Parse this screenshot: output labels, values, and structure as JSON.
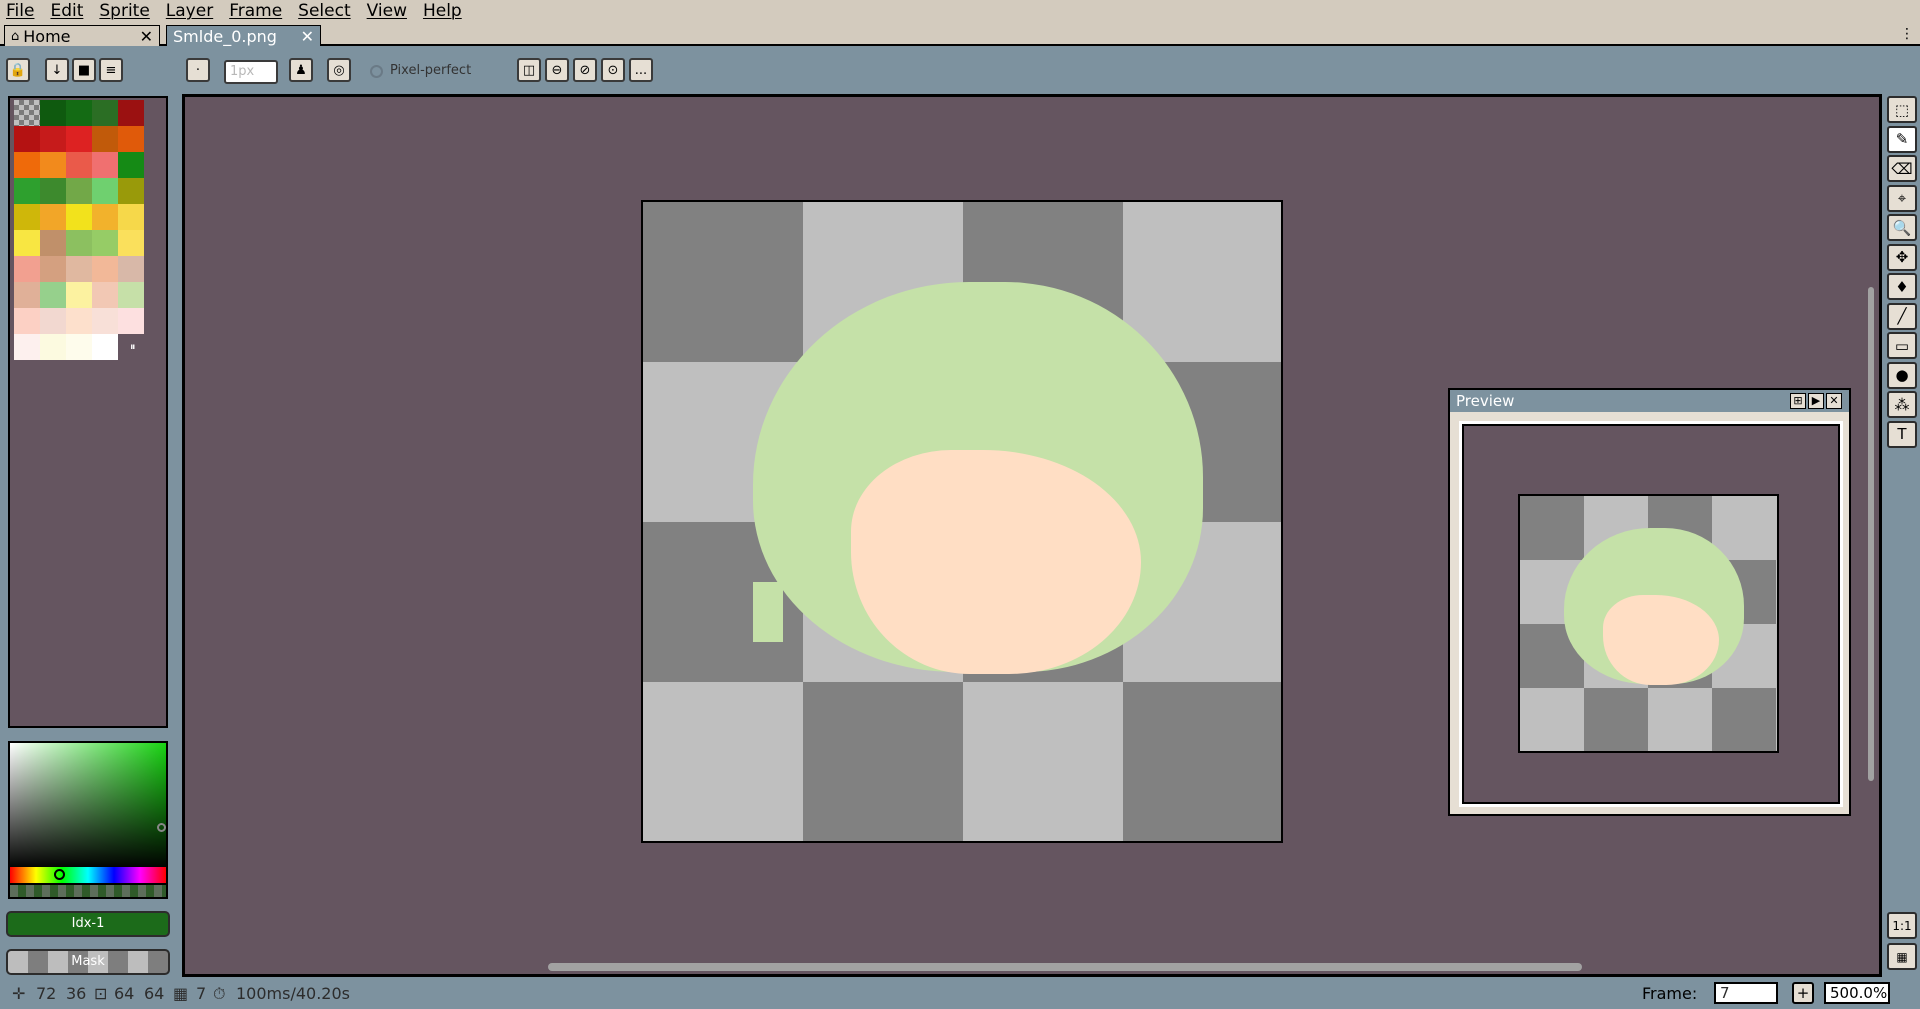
{
  "menu": [
    "File",
    "Edit",
    "Sprite",
    "Layer",
    "Frame",
    "Select",
    "View",
    "Help"
  ],
  "tabs": [
    {
      "label": "Home",
      "icon": "home-icon",
      "close": "✕"
    },
    {
      "label": "Smlde_0.png",
      "close": "✕"
    }
  ],
  "tabbar_menu_icon": "⋮",
  "toolbar": {
    "layer_buttons": [
      "🔒",
      "↓",
      "■",
      "≡"
    ],
    "brush_type_icon": "·",
    "brush_size_placeholder": "1px",
    "ink_icon": "♟",
    "pixel_perfect_label": "Pixel-perfect",
    "symmetry_buttons": [
      "◫",
      "⊖",
      "⊘",
      "⊙",
      "..."
    ]
  },
  "palette": {
    "colors": [
      "#7b7b7b",
      "#0f5a0f",
      "#146b14",
      "#2b6e24",
      "#9b1111",
      "#b41212",
      "#c61b1b",
      "#dd2222",
      "#c15a0a",
      "#e05a0a",
      "#ef6a0a",
      "#f28a1c",
      "#ea5a4a",
      "#f07070",
      "#158a15",
      "#2ea02e",
      "#3d8a2d",
      "#72a848",
      "#6fd06f",
      "#999a0a",
      "#cfb70a",
      "#f2a628",
      "#f2e21c",
      "#f2b22c",
      "#f6d84a",
      "#f8e642",
      "#c0906a",
      "#8cc060",
      "#96cc66",
      "#fae05c",
      "#f2a090",
      "#d4a080",
      "#e0b8a0",
      "#f2b898",
      "#d8b8a8",
      "#e0b098",
      "#96d08c",
      "#fcf2a0",
      "#f2c8b4",
      "#c6e0a8",
      "#fcd0c4",
      "#f2d8d0",
      "#fde0cc",
      "#f8e0d8",
      "#fde0e0",
      "#fdf0ee",
      "#fcfae0",
      "#fefcec",
      "#ffffff"
    ],
    "more_icon": "⏸"
  },
  "color_fg_label": "Idx-1",
  "color_bg_label": "Mask",
  "colors": {
    "accent": "#7d929f",
    "canvas_bg": "#655560",
    "checker_dark": "#818181",
    "checker_light": "#bfbfbf",
    "green_blob": "#c5e1a8",
    "peach_blob": "#ffdec4",
    "fg_color": "#1c6b1a"
  },
  "preview": {
    "title": "Preview",
    "buttons": [
      "⊞",
      "▶",
      "✕"
    ]
  },
  "tools": [
    {
      "name": "marquee-icon",
      "glyph": "⬚"
    },
    {
      "name": "pencil-icon",
      "glyph": "✎"
    },
    {
      "name": "eraser-icon",
      "glyph": "⌫"
    },
    {
      "name": "eyedropper-icon",
      "glyph": "⌖"
    },
    {
      "name": "zoom-icon",
      "glyph": "🔍"
    },
    {
      "name": "move-icon",
      "glyph": "✥"
    },
    {
      "name": "paint-bucket-icon",
      "glyph": "♦"
    },
    {
      "name": "line-icon",
      "glyph": "╱"
    },
    {
      "name": "rectangle-icon",
      "glyph": "▭"
    },
    {
      "name": "blur-icon",
      "glyph": "●"
    },
    {
      "name": "spray-icon",
      "glyph": "⁂"
    },
    {
      "name": "text-icon",
      "glyph": "T"
    }
  ],
  "bottom_tools": [
    {
      "name": "actual-size-icon",
      "glyph": "1:1"
    },
    {
      "name": "timeline-icon",
      "glyph": "▦"
    }
  ],
  "status": {
    "cursor_icon": "✛",
    "cursor_x": "72",
    "cursor_y": "36",
    "size_icon": "⊡",
    "width": "64",
    "height": "64",
    "frame_icon": "▦",
    "frame_count": "7",
    "duration_icon": "⏱",
    "duration": "100ms/40.20s",
    "frame_label": "Frame:",
    "frame_value": "7",
    "frame_add": "+",
    "zoom": "500.0%"
  }
}
